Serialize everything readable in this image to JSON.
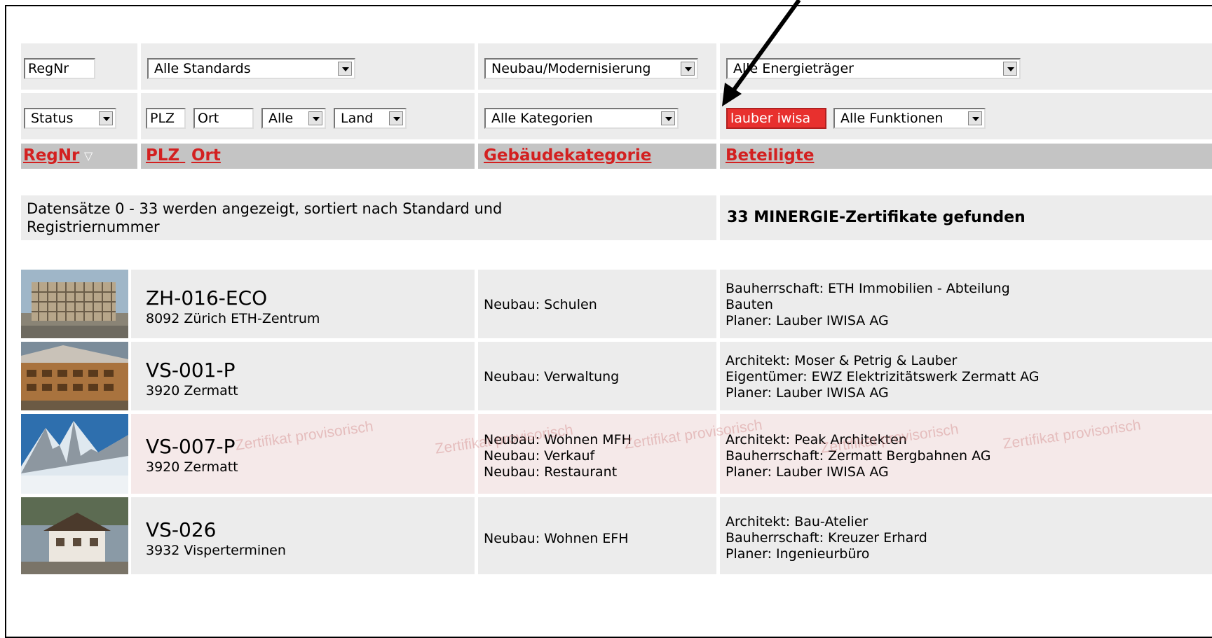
{
  "filters": {
    "regnr": "RegNr",
    "standard": "Alle Standards",
    "bauart": "Neubau/Modernisierung",
    "energie": "Alle Energieträger",
    "status": "Status",
    "plz": "PLZ",
    "ort": "Ort",
    "kanton": "Alle",
    "land": "Land",
    "kategorie": "Alle Kategorien",
    "beteiligte": "lauber iwisa",
    "funktion": "Alle Funktionen"
  },
  "headers": {
    "regnr": "RegNr",
    "sort_icon": "▽",
    "plz": "PLZ",
    "ort": "Ort",
    "kategorie": "Gebäudekategorie",
    "beteiligte": "Beteiligte"
  },
  "info": {
    "datasets": "Datensätze 0 - 33 werden angezeigt, sortiert nach Standard und Registriernummer",
    "count": "33 MINERGIE-Zertifikate gefunden"
  },
  "watermark": "Zertifikat provisorisch",
  "rows": [
    {
      "regnr": "ZH-016-ECO",
      "location": "8092 Zürich ETH-Zentrum",
      "categories": [
        "Neubau: Schulen"
      ],
      "participants": [
        "Bauherrschaft: ETH Immobilien - Abteilung",
        "Bauten",
        "Planer: Lauber IWISA AG"
      ],
      "provisional": false
    },
    {
      "regnr": "VS-001-P",
      "location": "3920 Zermatt",
      "categories": [
        "Neubau: Verwaltung"
      ],
      "participants": [
        "Architekt: Moser & Petrig & Lauber",
        "Eigentümer: EWZ Elektrizitätswerk Zermatt AG",
        "Planer: Lauber IWISA AG"
      ],
      "provisional": false
    },
    {
      "regnr": "VS-007-P",
      "location": "3920 Zermatt",
      "categories": [
        "Neubau: Wohnen MFH",
        "Neubau: Verkauf",
        "Neubau: Restaurant"
      ],
      "participants": [
        "Architekt: Peak Architekten",
        "Bauherrschaft: Zermatt Bergbahnen AG",
        "Planer: Lauber IWISA AG"
      ],
      "provisional": true
    },
    {
      "regnr": "VS-026",
      "location": "3932 Visperterminen",
      "categories": [
        "Neubau: Wohnen EFH"
      ],
      "participants": [
        "Architekt: Bau-Atelier",
        "Bauherrschaft: Kreuzer Erhard",
        "Planer: Ingenieurbüro"
      ],
      "provisional": false
    }
  ]
}
